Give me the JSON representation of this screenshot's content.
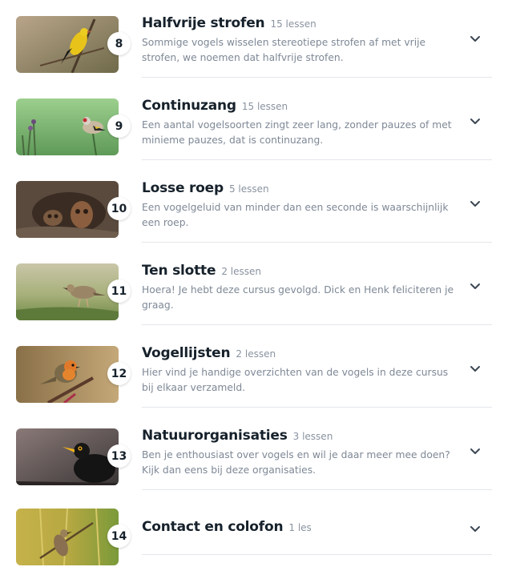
{
  "chapters": [
    {
      "number": "8",
      "title": "Halfvrije strofen",
      "count": "15 lessen",
      "description": "Sommige vogels wisselen stereotiepe strofen af met vrije strofen, we noemen dat halfvrije strofen.",
      "image": "golden-oriole-photo"
    },
    {
      "number": "9",
      "title": "Continuzang",
      "count": "15 lessen",
      "description": "Een aantal vogelsoorten zingt zeer lang, zonder pauzes of met minieme pauzes, dat is continuzang.",
      "image": "goldfinch-photo"
    },
    {
      "number": "10",
      "title": "Losse roep",
      "count": "5 lessen",
      "description": "Een vogelgeluid van minder dan een seconde is waarschijnlijk een roep.",
      "image": "owl-photo"
    },
    {
      "number": "11",
      "title": "Ten slotte",
      "count": "2 lessen",
      "description": "Hoera! Je hebt deze cursus gevolgd. Dick en Henk feliciteren je graag.",
      "image": "pipit-photo"
    },
    {
      "number": "12",
      "title": "Vogellijsten",
      "count": "2 lessen",
      "description": "Hier vind je handige overzichten van de vogels in deze cursus bij elkaar verzameld.",
      "image": "robin-photo"
    },
    {
      "number": "13",
      "title": "Natuurorganisaties",
      "count": "3 lessen",
      "description": "Ben je enthousiast over vogels en wil je daar meer mee doen? Kijk dan eens bij deze organisaties.",
      "image": "blackbird-photo"
    },
    {
      "number": "14",
      "title": "Contact en colofon",
      "count": "1 les",
      "description": "",
      "image": "warbler-photo"
    }
  ],
  "icons": {
    "expand": "chevron-down-icon"
  },
  "colors": {
    "title": "#16212b",
    "muted": "#8a93a0",
    "divider": "#e3e6ea"
  }
}
